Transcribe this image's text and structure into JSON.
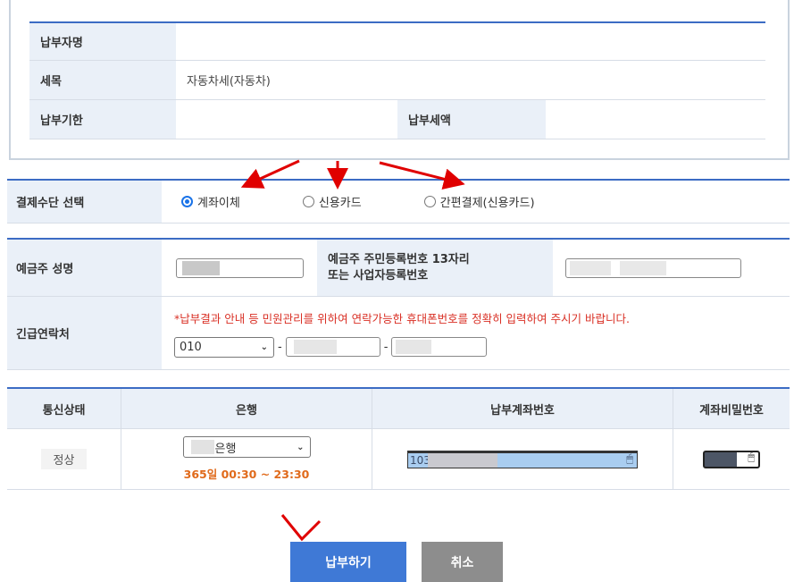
{
  "info": {
    "payer_name_label": "납부자명",
    "payer_name_value": "",
    "tax_item_label": "세목",
    "tax_item_value": "자동차세(자동차)",
    "due_date_label": "납부기한",
    "due_date_value": "",
    "amount_label": "납부세액",
    "amount_value": ""
  },
  "payment_method": {
    "label": "결제수단 선택",
    "options": [
      {
        "label": "계좌이체",
        "selected": true
      },
      {
        "label": "신용카드",
        "selected": false
      },
      {
        "label": "간편결제(신용카드)",
        "selected": false
      }
    ]
  },
  "depositor": {
    "name_label": "예금주 성명",
    "id_label_line1": "예금주 주민등록번호 13자리",
    "id_label_line2": "또는 사업자등록번호",
    "contact_label": "긴급연락처",
    "contact_notice": "*납부결과 안내 등 민원관리를 위하여 연락가능한 휴대폰번호를 정확히 입력하여 주시기 바랍니다.",
    "phone_prefix": "010",
    "phone_separator": "-"
  },
  "bank": {
    "headers": [
      "통신상태",
      "은행",
      "납부계좌번호",
      "계좌비밀번호"
    ],
    "status": "정상",
    "bank_select": "은행",
    "hours": "365일 00:30 ~ 23:30",
    "account_prefix": "103"
  },
  "buttons": {
    "pay": "납부하기",
    "cancel": "취소"
  },
  "colors": {
    "accent_blue": "#3c6cc4",
    "label_bg": "#eaf0f8",
    "pay_button": "#3f79d6",
    "cancel_button": "#8d8d8d",
    "annotation_red": "#e00000",
    "notice_red": "#d93025",
    "hours_orange": "#e06a1b"
  }
}
